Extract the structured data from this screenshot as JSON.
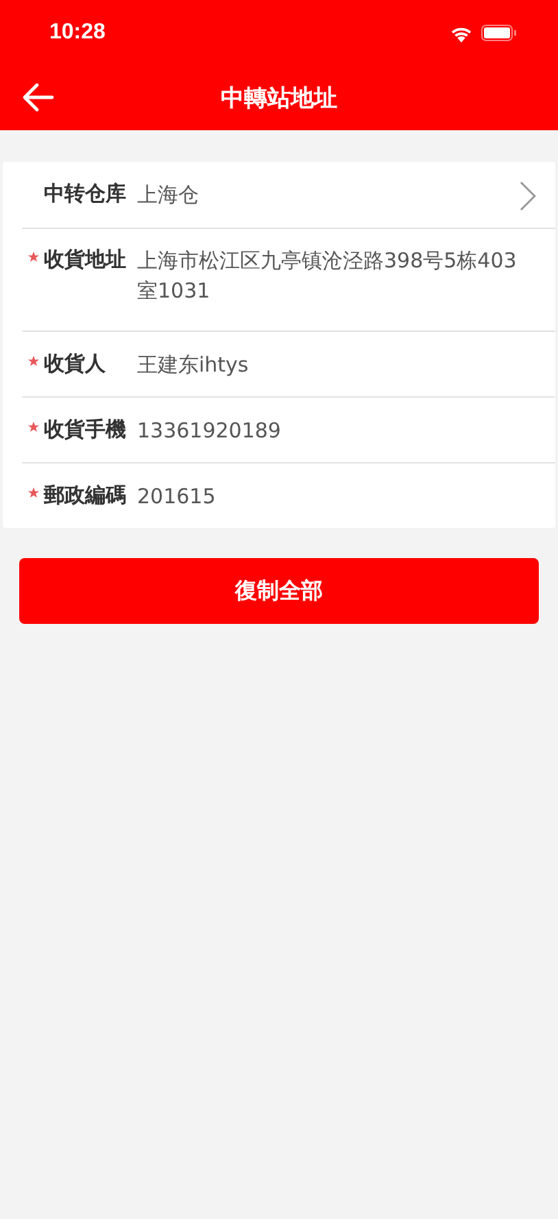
{
  "status_bar": {
    "time": "10:28"
  },
  "nav": {
    "title": "中轉站地址"
  },
  "fields": [
    {
      "kind": "select",
      "label": "中转仓库",
      "value": "上海仓",
      "required": false
    },
    {
      "kind": "text",
      "label": "收貨地址",
      "value": "上海市松江区九亭镇沧泾路398号5栋403室1031",
      "required": true
    },
    {
      "kind": "text",
      "label": "收貨人",
      "value": "王建东ihtys",
      "required": true
    },
    {
      "kind": "text",
      "label": "收貨手機",
      "value": "13361920189",
      "required": true
    },
    {
      "kind": "text",
      "label": "郵政編碼",
      "value": "201615",
      "required": true
    }
  ],
  "copy_button": {
    "label": "復制全部"
  }
}
